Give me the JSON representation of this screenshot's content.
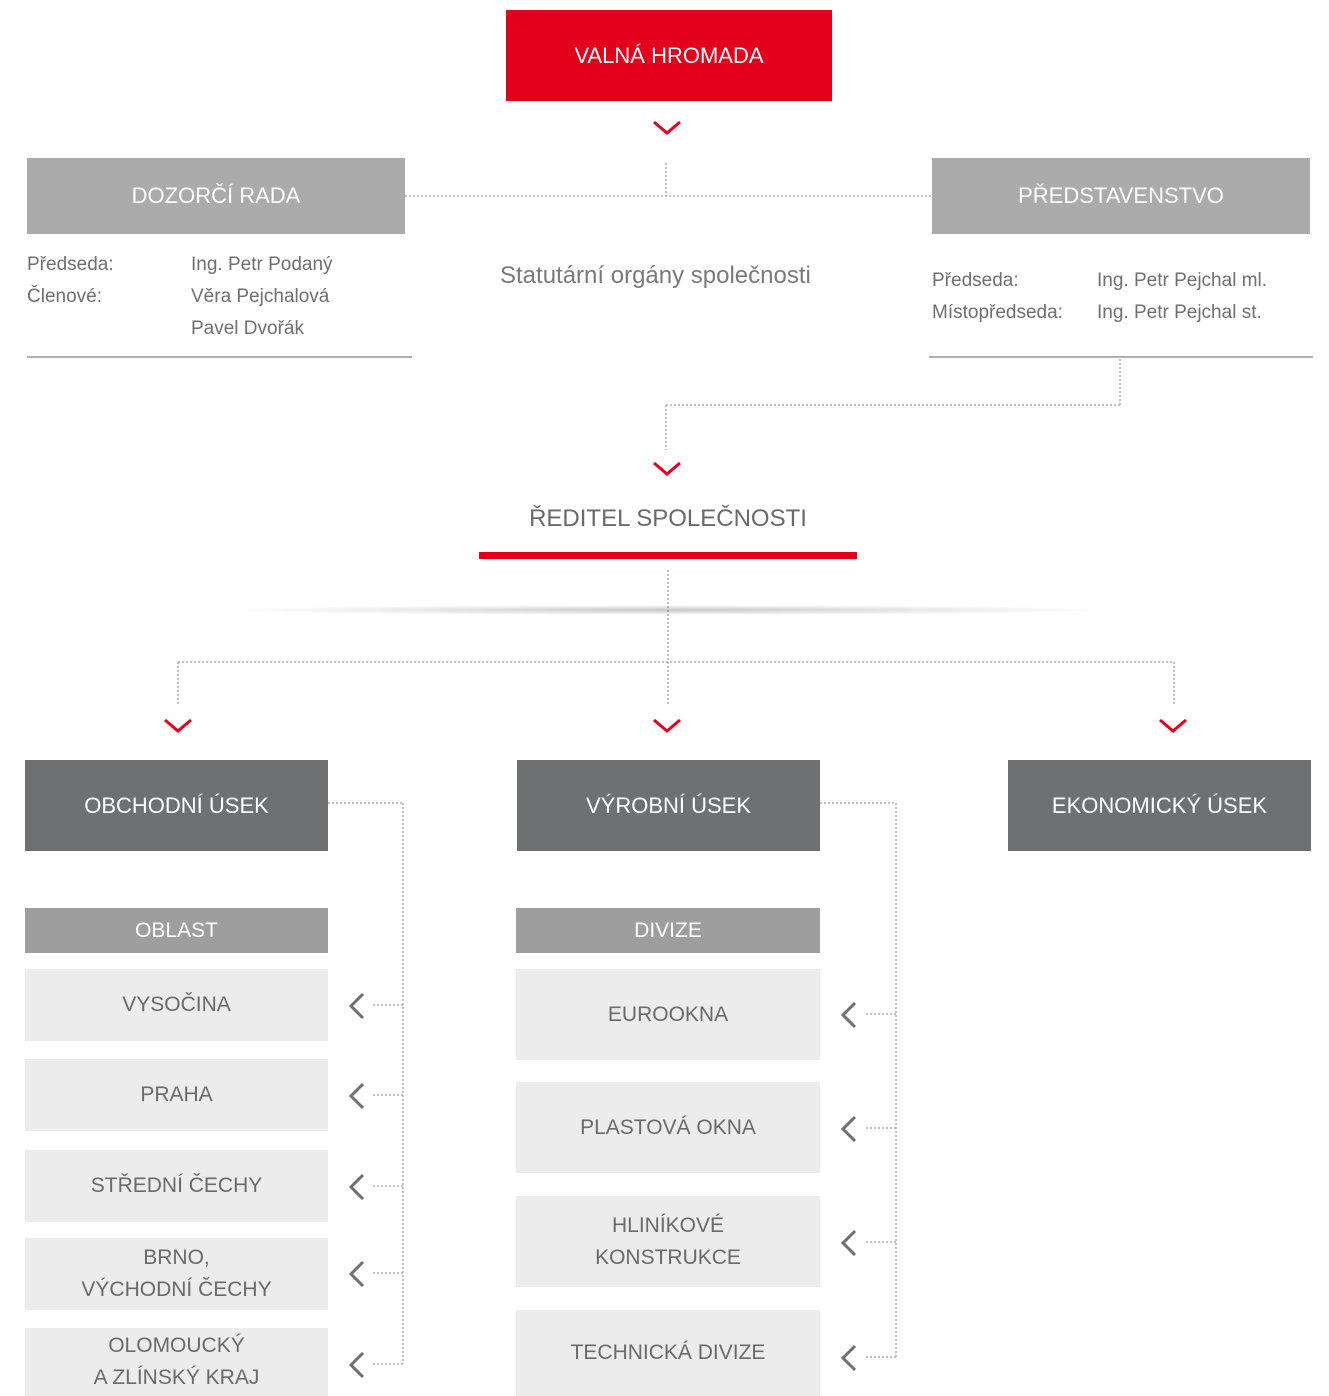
{
  "top": {
    "label": "VALNÁ HROMADA",
    "color": "#e2001a"
  },
  "center_label": "Statutární orgány společnosti",
  "dozorci_rada": {
    "title": "DOZORČÍ RADA",
    "rows": [
      {
        "role": "Předseda:",
        "name": "Ing. Petr Podaný"
      },
      {
        "role": "Členové:",
        "name": "Věra Pejchalová"
      },
      {
        "role": "",
        "name": "Pavel Dvořák"
      }
    ]
  },
  "predstavenstvo": {
    "title": "PŘEDSTAVENSTVO",
    "rows": [
      {
        "role": "Předseda:",
        "name": "Ing. Petr Pejchal ml."
      },
      {
        "role": "Místopředseda:",
        "name": "Ing. Petr Pejchal st."
      }
    ]
  },
  "director": {
    "label": "ŘEDITEL SPOLEČNOSTI"
  },
  "departments": [
    {
      "label": "OBCHODNÍ ÚSEK"
    },
    {
      "label": "VÝROBNÍ ÚSEK"
    },
    {
      "label": "EKONOMICKÝ ÚSEK"
    }
  ],
  "oblast": {
    "header": "OBLAST",
    "items": [
      "VYSOČINA",
      "PRAHA",
      "STŘEDNÍ ČECHY",
      "BRNO,\nVÝCHODNÍ ČECHY",
      "OLOMOUCKÝ\nA ZLÍNSKÝ KRAJ"
    ]
  },
  "divize": {
    "header": "DIVIZE",
    "items": [
      "EUROOKNA",
      "PLASTOVÁ OKNA",
      "HLINÍKOVÉ\nKONSTRUKCE",
      "TECHNICKÁ DIVIZE"
    ]
  },
  "icons": {
    "down": "chevron-down-icon",
    "left": "chevron-left-icon"
  },
  "colors": {
    "accent_red": "#e2001a",
    "box_gray": "#ababab",
    "box_dark": "#6f7072",
    "box_light": "#ececec",
    "connector": "#9a9a9a",
    "chevron_left": "#6f7072"
  }
}
